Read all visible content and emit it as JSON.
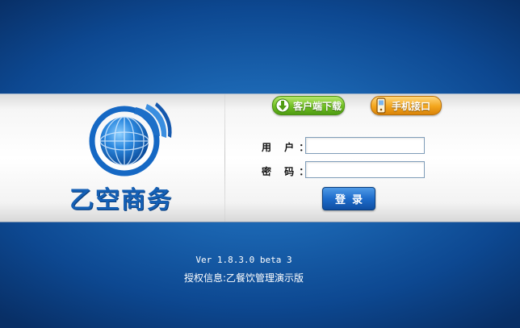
{
  "brand": {
    "name": "乙空商务"
  },
  "header_buttons": {
    "download": {
      "label": "客户端下载",
      "icon": "download-arrow-icon",
      "color": "#6fbf22"
    },
    "mobile": {
      "label": "手机接口",
      "icon": "mobile-phone-icon",
      "color": "#f3a51c"
    }
  },
  "form": {
    "username_label": "用 户",
    "password_label": "密 码",
    "colon": "：",
    "username_value": "",
    "password_value": "",
    "login_label": "登录"
  },
  "footer": {
    "version": "Ver 1.8.3.0 beta 3",
    "license": "授权信息:乙餐饮管理演示版"
  },
  "colors": {
    "background": "#1a64b0",
    "brand_blue": "#1560b5",
    "login_button": "#1e6ccb"
  }
}
